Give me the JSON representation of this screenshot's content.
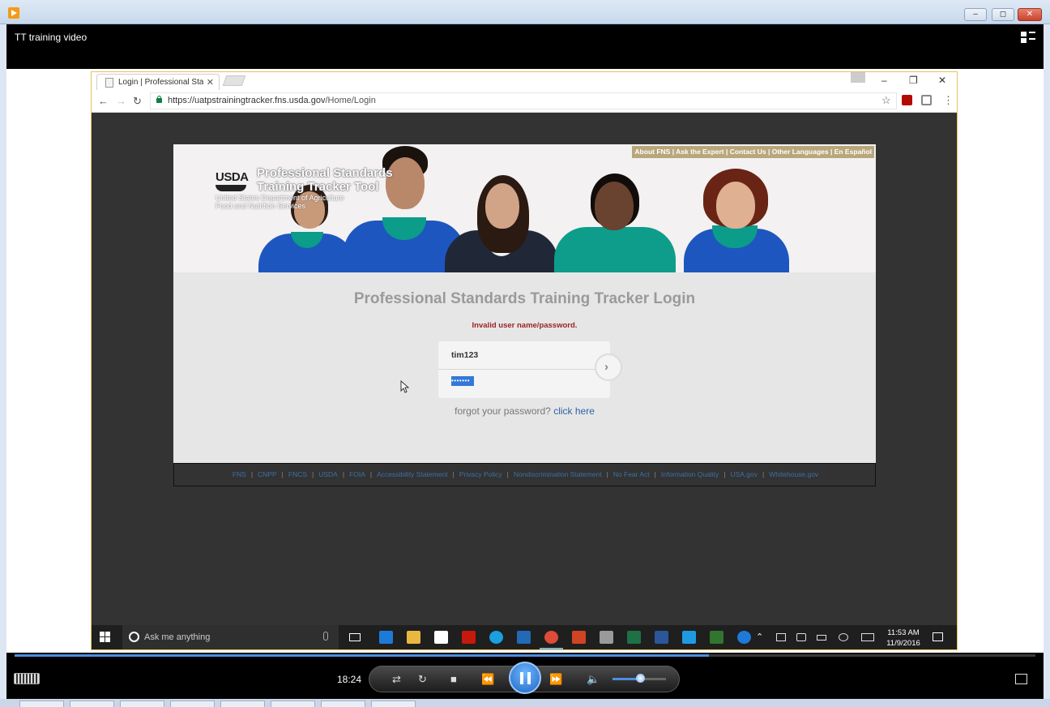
{
  "player": {
    "title": "TT training video",
    "time": "18:24",
    "progress_fraction": 0.68,
    "volume_fraction": 0.5
  },
  "browser": {
    "tab_title": "Login | Professional Stan",
    "url_host": "https://uatpstrainingtracker.fns.usda.gov",
    "url_path": "/Home/Login"
  },
  "page": {
    "top_links": "About FNS | Ask the Expert | Contact Us | Other Languages | En Español",
    "usda_logo": "USDA",
    "site_title_line1": "Professional Standards",
    "site_title_line2": "Training Tracker Tool",
    "agency_line1": "United States Department of Agriculture",
    "agency_line2": "Food and Nutrition Services",
    "login_heading": "Professional Standards Training Tracker Login",
    "error_message": "Invalid user name/password.",
    "username_value": "tim123",
    "password_mask": "•••••••",
    "forgot_text": "forgot your password?",
    "forgot_link": "click here",
    "footer_links": [
      "FNS",
      "CNPP",
      "FNCS",
      "USDA",
      "FOIA",
      "Accessibility Statement",
      "Privacy Policy",
      "Nondiscrimination Statement",
      "No Fear Act",
      "Information Quality",
      "USA.gov",
      "Whitehouse.gov"
    ]
  },
  "taskbar": {
    "search_placeholder": "Ask me anything",
    "time": "11:53 AM",
    "date": "11/9/2016",
    "apps": [
      {
        "name": "edge-icon",
        "color": "#1e7ad8"
      },
      {
        "name": "file-explorer-icon",
        "color": "#e8b840"
      },
      {
        "name": "store-icon",
        "color": "#ffffff"
      },
      {
        "name": "acrobat-icon",
        "color": "#c4190b"
      },
      {
        "name": "skype-icon",
        "color": "#1a9fe0"
      },
      {
        "name": "outlook-icon",
        "color": "#2269b6"
      },
      {
        "name": "chrome-icon",
        "color": "#dd4b39"
      },
      {
        "name": "powerpoint-icon",
        "color": "#d04423"
      },
      {
        "name": "network-app-icon",
        "color": "#9a9a9a"
      },
      {
        "name": "excel-icon",
        "color": "#1e7145"
      },
      {
        "name": "word-icon",
        "color": "#2b579a"
      },
      {
        "name": "internet-explorer-icon",
        "color": "#1e9be0"
      },
      {
        "name": "project-icon",
        "color": "#31752f"
      },
      {
        "name": "help-icon",
        "color": "#1e7ad8"
      }
    ]
  },
  "colors": {
    "error": "#9b2323",
    "link": "#2b63a8",
    "accent": "#4d8ee0"
  }
}
